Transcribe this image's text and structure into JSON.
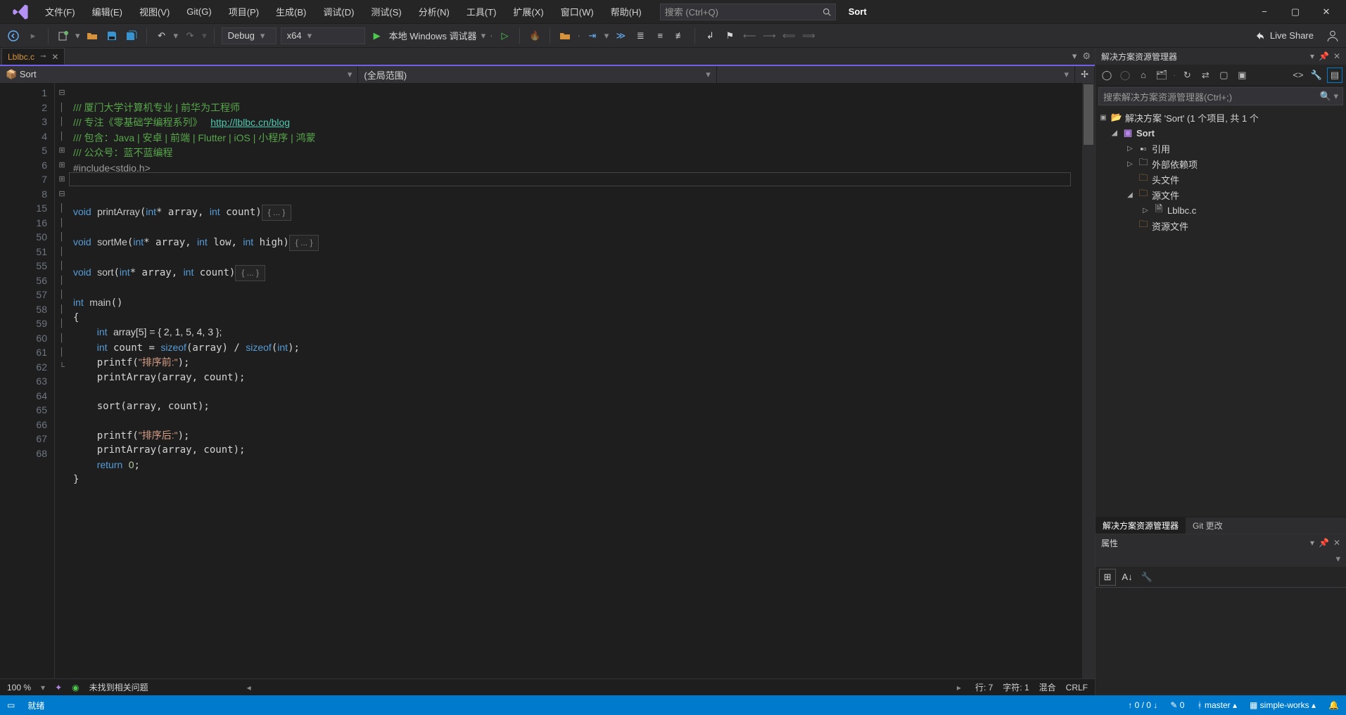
{
  "menu": {
    "items": [
      "文件(F)",
      "编辑(E)",
      "视图(V)",
      "Git(G)",
      "项目(P)",
      "生成(B)",
      "调试(D)",
      "测试(S)",
      "分析(N)",
      "工具(T)",
      "扩展(X)",
      "窗口(W)",
      "帮助(H)"
    ]
  },
  "search": {
    "placeholder": "搜索 (Ctrl+Q)"
  },
  "app_title": "Sort",
  "toolbar": {
    "config": "Debug",
    "platform": "x64",
    "debugger_label": "本地 Windows 调试器",
    "live_share": "Live Share"
  },
  "tab": {
    "filename": "Lblbc.c"
  },
  "dropdowns": {
    "left": "Sort",
    "mid": "(全局范围)"
  },
  "code": {
    "comment1": "/// 厦门大学计算机专业 | 前华为工程师",
    "comment2_pre": "/// 专注《零基础学编程系列》   ",
    "comment2_link": "http://lblbc.cn/blog",
    "comment3": "/// 包含：Java | 安卓 | 前端 | Flutter | iOS | 小程序 | 鸿蒙",
    "comment4": "/// 公众号：蓝不蓝编程",
    "include": "#include<stdio.h>",
    "printArray": "printArray",
    "sortMe": "sortMe",
    "sort": "sort",
    "main": "main",
    "array_decl": "array[5] = { 2, 1, 5, 4, 3 };",
    "before": "\"排序前:\"",
    "after": "\"排序后:\"",
    "fold": "{ ... }"
  },
  "line_numbers": [
    "1",
    "2",
    "3",
    "4",
    "5",
    "6",
    "7",
    "8",
    "15",
    "16",
    "50",
    "51",
    "55",
    "56",
    "57",
    "58",
    "59",
    "60",
    "61",
    "62",
    "63",
    "64",
    "65",
    "66",
    "67",
    "68"
  ],
  "editor_status": {
    "zoom": "100 %",
    "issues": "未找到相关问题",
    "line": "行: 7",
    "col": "字符: 1",
    "mode": "混合",
    "eol": "CRLF"
  },
  "solution_explorer": {
    "title": "解决方案资源管理器",
    "search_placeholder": "搜索解决方案资源管理器(Ctrl+;)",
    "root": "解决方案 'Sort' (1 个项目, 共 1 个",
    "project": "Sort",
    "nodes": {
      "refs": "引用",
      "ext": "外部依赖项",
      "headers": "头文件",
      "sources": "源文件",
      "file": "Lblbc.c",
      "resources": "资源文件"
    },
    "bottom_tabs": [
      "解决方案资源管理器",
      "Git 更改"
    ]
  },
  "properties": {
    "title": "属性"
  },
  "statusbar": {
    "ready": "就绪",
    "errcount": "0 / 0",
    "changes": "0",
    "branch": "master",
    "repo": "simple-works"
  }
}
